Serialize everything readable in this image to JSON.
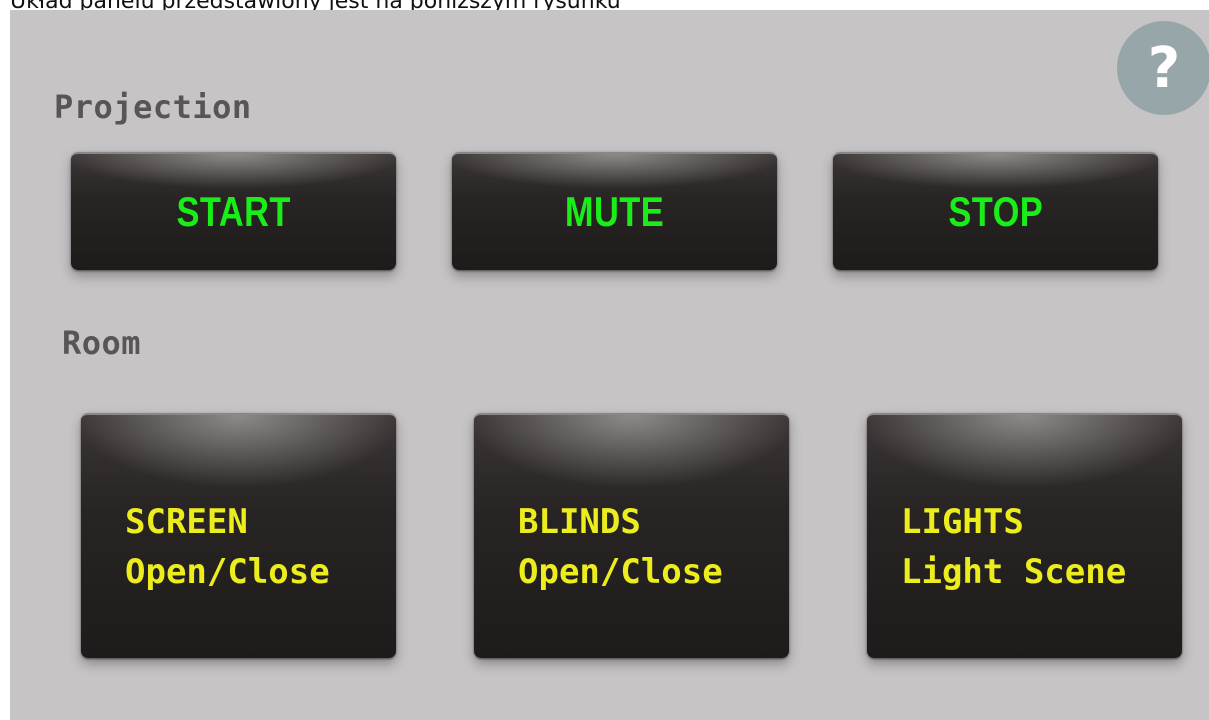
{
  "caption": "Układ panelu przedstawiony jest na poniższym rysunku",
  "help_icon": {
    "icon": "question-mark",
    "glyph": "?",
    "color": "#97a6a8"
  },
  "projection": {
    "title": "Projection",
    "buttons": [
      {
        "label": "START"
      },
      {
        "label": "MUTE"
      },
      {
        "label": "STOP"
      }
    ]
  },
  "room": {
    "title": "Room",
    "buttons": [
      {
        "line1": "SCREEN",
        "line2": "Open/Close"
      },
      {
        "line1": "BLINDS",
        "line2": "Open/Close"
      },
      {
        "line1": "LIGHTS",
        "line2": "Light Scene"
      }
    ]
  },
  "colors": {
    "panel_background": "#c6c4c5",
    "button_face": "#2a2525",
    "projection_text": "#19ee19",
    "room_text": "#eded1e",
    "section_label": "#575557"
  }
}
